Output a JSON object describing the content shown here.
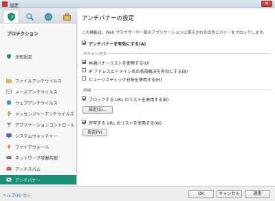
{
  "window": {
    "title": "設定",
    "close_label": "✕"
  },
  "tabs": [
    {
      "name": "protection",
      "icon": "shield-icon",
      "active": true
    },
    {
      "name": "scan",
      "icon": "search-icon",
      "active": false
    },
    {
      "name": "update",
      "icon": "globe-icon",
      "active": false
    },
    {
      "name": "options",
      "icon": "briefcase-icon",
      "active": false
    }
  ],
  "sidebar": {
    "section": "プロテクション",
    "items": [
      {
        "label": "全般設定",
        "icon": "general-icon"
      },
      {
        "label": "ファイルアンチウイルス",
        "icon": "folder-icon"
      },
      {
        "label": "メールアンチウイルス",
        "icon": "mail-icon"
      },
      {
        "label": "ウェブアンチウイルス",
        "icon": "web-icon"
      },
      {
        "label": "メッセンジャーアンチウイルス",
        "icon": "messenger-icon"
      },
      {
        "label": "アプリケーションコントロール",
        "icon": "app-control-icon"
      },
      {
        "label": "システムウォッチャー",
        "icon": "monitor-icon"
      },
      {
        "label": "ファイアウォール",
        "icon": "firewall-icon"
      },
      {
        "label": "ネットワーク攻撃防御",
        "icon": "network-icon"
      },
      {
        "label": "アンチスパム",
        "icon": "antispam-icon"
      },
      {
        "label": "アンチバナー",
        "icon": "antibanner-icon",
        "active": true
      }
    ]
  },
  "main": {
    "title": "アンチバナーの設定",
    "description": "この機能は、Web ブラウザーや一部のアプリケーションに表示される広告とバナーをブロックします。",
    "enable_label": "アンチバナーを有効にする(A)",
    "scan_group": "スキャン方法",
    "scan_options": [
      {
        "label": "共通バナーリストを使用する(U)",
        "checked": true
      },
      {
        "label": "IP アドレスとドメイン名の名前解決を有効にする(B)",
        "checked": false
      },
      {
        "label": "ヒューリスティック分析を使用する(H)",
        "checked": false
      }
    ],
    "advanced_group": "詳細",
    "block_list_label": "ブロックする URL のリストを使用する(B)",
    "settings_button_1": "設定(S)...",
    "allow_list_label": "許可する URL のリストを使用する(W)",
    "settings_button_2": "設定(N)"
  },
  "footer": {
    "help": "ヘルプ(H)",
    "restore": "復元",
    "ok": "OK",
    "cancel": "キャンセル",
    "apply": "適用"
  },
  "colors": {
    "accent": "#1a8f78"
  }
}
